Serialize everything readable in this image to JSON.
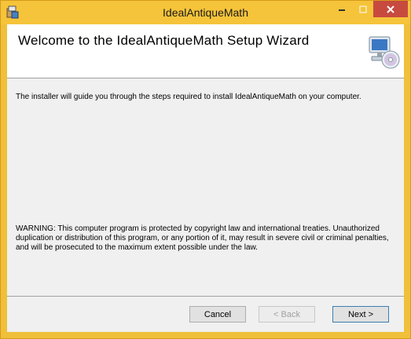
{
  "window": {
    "title": "IdealAntiqueMath"
  },
  "header": {
    "title": "Welcome to the IdealAntiqueMath Setup Wizard",
    "graphic_icon": "computer-with-disc-icon"
  },
  "body": {
    "intro": "The installer will guide you through the steps required to install IdealAntiqueMath on your computer.",
    "warning": "WARNING: This computer program is protected by copyright law and international treaties. Unauthorized duplication or distribution of this program, or any portion of it, may result in severe civil or criminal penalties, and will be prosecuted to the maximum extent possible under the law."
  },
  "footer": {
    "cancel_label": "Cancel",
    "back_label": "< Back",
    "next_label": "Next >"
  },
  "colors": {
    "titlebar": "#f5c43a",
    "close_button": "#c74a3f"
  }
}
